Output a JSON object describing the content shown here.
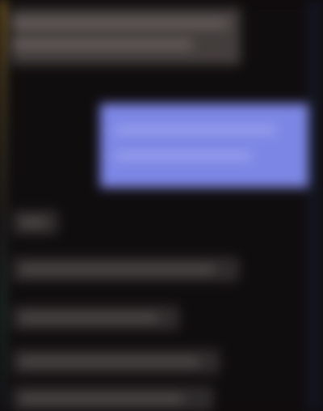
{
  "theme": {
    "background": "#100d0e",
    "highlight": "#7c86e4",
    "accent": "#b08a2a"
  },
  "header": {
    "note": ""
  },
  "highlighted_item": {
    "label": ""
  },
  "list": {
    "section_label": "",
    "items": [
      "",
      "",
      "",
      ""
    ]
  }
}
